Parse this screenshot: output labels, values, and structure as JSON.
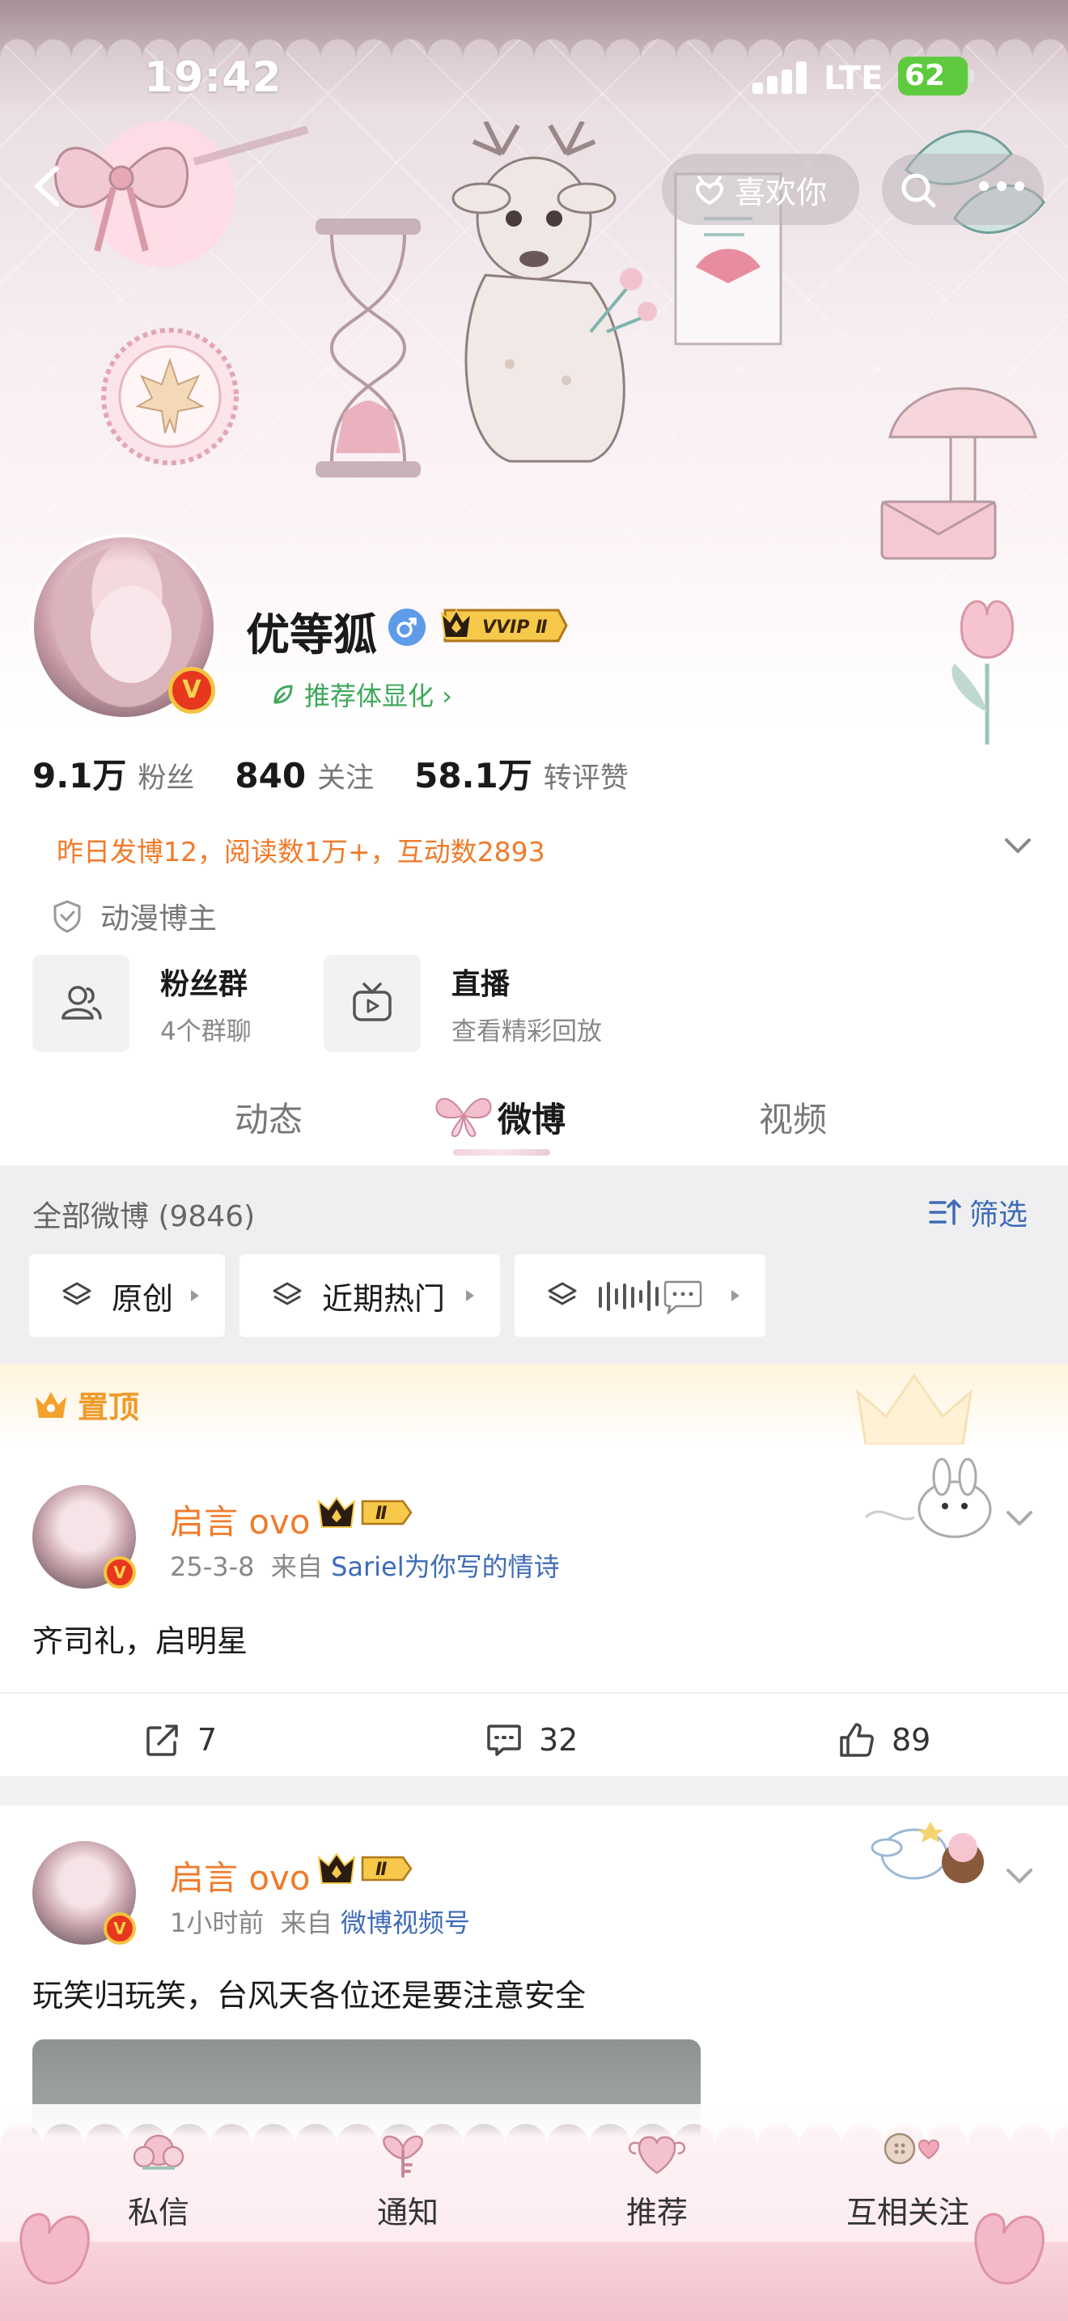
{
  "status_bar": {
    "time": "19:42",
    "network": "LTE",
    "battery": "62"
  },
  "header": {
    "like_label": "喜欢你"
  },
  "profile": {
    "name": "优等狐",
    "badge": "VVIP Ⅱ",
    "recommend_label": "推荐体显化 ›",
    "stats": [
      {
        "value": "9.1万",
        "label": "粉丝"
      },
      {
        "value": "840",
        "label": "关注"
      },
      {
        "value": "58.1万",
        "label": "转评赞"
      }
    ],
    "activity": "昨日发博12，阅读数1万+，互动数2893",
    "tag": "动漫博主",
    "cards": [
      {
        "title": "粉丝群",
        "subtitle": "4个群聊",
        "icon": "group-icon"
      },
      {
        "title": "直播",
        "subtitle": "查看精彩回放",
        "icon": "tv-icon"
      }
    ]
  },
  "tabs": {
    "items": [
      "动态",
      "微博",
      "视频"
    ],
    "active": "微博"
  },
  "feed": {
    "all_label": "全部微博 (9846)",
    "filter_label": "筛选",
    "chips": [
      "原创",
      "近期热门"
    ],
    "pinned_label": "置顶"
  },
  "posts": [
    {
      "author": "启言 ovo",
      "badge": "Ⅱ",
      "date": "25-3-8",
      "from": "来自",
      "source": "Sariel为你写的情诗",
      "text": "齐司礼，启明星",
      "reposts": "7",
      "comments": "32",
      "likes": "89"
    },
    {
      "author": "启言 ovo",
      "badge": "Ⅱ",
      "date": "1小时前",
      "from": "来自",
      "source": "微博视频号",
      "text": "玩笑归玩笑，台风天各位还是要注意安全"
    }
  ],
  "bottom_nav": [
    "私信",
    "通知",
    "推荐",
    "互相关注"
  ],
  "colors": {
    "accent_orange": "#f07b2a",
    "link_blue": "#3e6bb7",
    "pinned_gold": "#f09a2a"
  }
}
